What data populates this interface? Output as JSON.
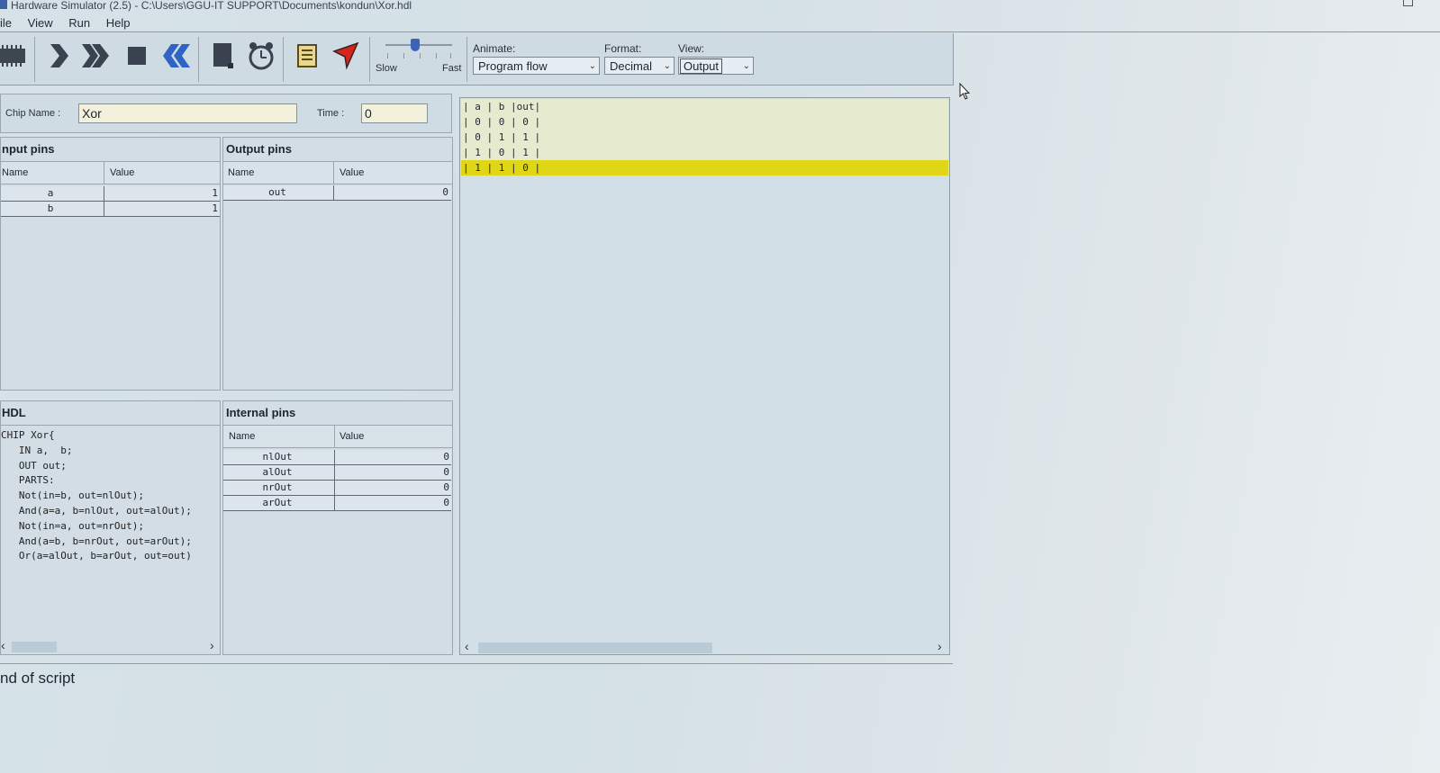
{
  "window": {
    "title": "Hardware Simulator (2.5) - C:\\Users\\GGU-IT SUPPORT\\Documents\\kondun\\Xor.hdl"
  },
  "menu": [
    "ile",
    "View",
    "Run",
    "Help"
  ],
  "toolbar": {
    "icons": [
      "load-chip-icon",
      "single-step-icon",
      "run-icon",
      "stop-icon",
      "reset-icon",
      "eval-icon",
      "clock-icon",
      "script-icon",
      "breakpoints-icon"
    ],
    "speed": {
      "slow_label": "Slow",
      "fast_label": "Fast",
      "level": 0.45
    },
    "animate": {
      "label": "Animate:",
      "value": "Program flow"
    },
    "format": {
      "label": "Format:",
      "value": "Decimal"
    },
    "view": {
      "label": "View:",
      "value": "Output"
    }
  },
  "chip": {
    "name_label": "Chip Name :",
    "name": "Xor",
    "time_label": "Time :",
    "time": "0"
  },
  "input_pins": {
    "title": "nput pins",
    "col_name": "Name",
    "col_value": "Value",
    "rows": [
      {
        "name": "a",
        "value": "1"
      },
      {
        "name": "b",
        "value": "1"
      }
    ]
  },
  "output_pins": {
    "title": "Output pins",
    "col_name": "Name",
    "col_value": "Value",
    "rows": [
      {
        "name": "out",
        "value": "0"
      }
    ]
  },
  "hdl": {
    "title": "HDL",
    "lines": [
      "CHIP Xor{",
      "   IN a,  b;",
      "   OUT out;",
      "   PARTS:",
      "   Not(in=b, out=nlOut);",
      "   And(a=a, b=nlOut, out=alOut);",
      "   Not(in=a, out=nrOut);",
      "   And(a=b, b=nrOut, out=arOut);",
      "   Or(a=alOut, b=arOut, out=out)"
    ]
  },
  "internal_pins": {
    "title": "Internal pins",
    "col_name": "Name",
    "col_value": "Value",
    "rows": [
      {
        "name": "nlOut",
        "value": "0"
      },
      {
        "name": "alOut",
        "value": "0"
      },
      {
        "name": "nrOut",
        "value": "0"
      },
      {
        "name": "arOut",
        "value": "0"
      }
    ]
  },
  "output_table": {
    "rows": [
      "| a | b |out|",
      "| 0 | 0 | 0 |",
      "| 0 | 1 | 1 |",
      "| 1 | 0 | 1 |",
      "| 1 | 1 | 0 |"
    ],
    "highlight_index": 4,
    "highlight_color": "#e0d615"
  },
  "status": {
    "message": "nd of script"
  }
}
